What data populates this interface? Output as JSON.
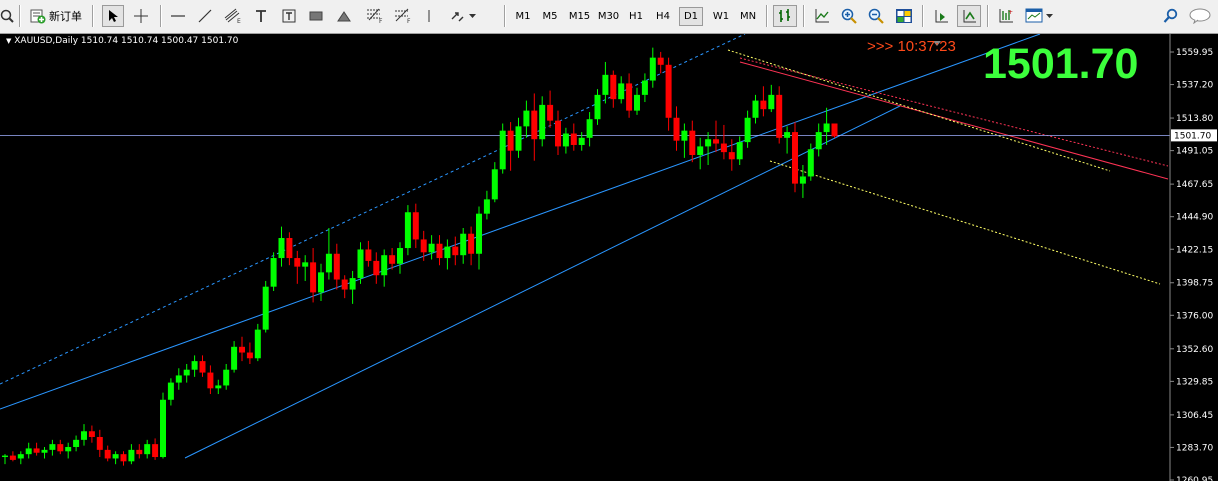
{
  "toolbar": {
    "new_order_label": "新订单",
    "timeframes": [
      "M1",
      "M5",
      "M15",
      "M30",
      "H1",
      "H4",
      "D1",
      "W1",
      "MN"
    ],
    "active_timeframe": "D1"
  },
  "chart": {
    "symbol_line": "XAUUSD,Daily  1510.74 1510.74 1500.47 1501.70",
    "timer": ">>> 10:37:23",
    "big_price": "1501.70",
    "current_price_label": "1501.70",
    "y_ticks": [
      "1559.95",
      "1537.20",
      "1513.80",
      "1491.05",
      "1467.65",
      "1444.90",
      "1422.15",
      "1398.75",
      "1376.00",
      "1352.60",
      "1329.85",
      "1306.45",
      "1283.70",
      "1260.95"
    ],
    "colors": {
      "bull": "#00ff00",
      "bear": "#ff0000",
      "channel": "#1e90ff",
      "trend_red": "#ff3355",
      "trend_yellow": "#ffff66",
      "price_line": "#a0b0ff"
    }
  },
  "chart_data": {
    "type": "candlestick",
    "title": "XAUUSD,Daily",
    "ylim": [
      1256,
      1568
    ],
    "last": {
      "open": 1510.74,
      "high": 1510.74,
      "low": 1500.47,
      "close": 1501.7
    },
    "candles": [
      [
        1277,
        1279,
        1272,
        1278
      ],
      [
        1278,
        1281,
        1274,
        1275
      ],
      [
        1276,
        1281,
        1272,
        1279
      ],
      [
        1279,
        1287,
        1276,
        1283
      ],
      [
        1283,
        1287,
        1278,
        1280
      ],
      [
        1280,
        1284,
        1276,
        1282
      ],
      [
        1282,
        1289,
        1278,
        1286
      ],
      [
        1286,
        1289,
        1279,
        1281
      ],
      [
        1281,
        1287,
        1276,
        1284
      ],
      [
        1284,
        1292,
        1281,
        1289
      ],
      [
        1289,
        1300,
        1285,
        1295
      ],
      [
        1295,
        1299,
        1287,
        1291
      ],
      [
        1291,
        1296,
        1277,
        1282
      ],
      [
        1282,
        1285,
        1274,
        1276
      ],
      [
        1276,
        1281,
        1272,
        1279
      ],
      [
        1279,
        1281,
        1271,
        1274
      ],
      [
        1274,
        1286,
        1272,
        1282
      ],
      [
        1282,
        1286,
        1276,
        1279
      ],
      [
        1279,
        1289,
        1276,
        1286
      ],
      [
        1286,
        1290,
        1275,
        1277
      ],
      [
        1277,
        1322,
        1276,
        1317
      ],
      [
        1317,
        1332,
        1313,
        1329
      ],
      [
        1329,
        1339,
        1324,
        1334
      ],
      [
        1334,
        1342,
        1329,
        1338
      ],
      [
        1338,
        1348,
        1333,
        1344
      ],
      [
        1344,
        1348,
        1333,
        1336
      ],
      [
        1336,
        1341,
        1321,
        1325
      ],
      [
        1325,
        1331,
        1321,
        1327
      ],
      [
        1327,
        1342,
        1324,
        1338
      ],
      [
        1338,
        1358,
        1336,
        1354
      ],
      [
        1354,
        1361,
        1344,
        1350
      ],
      [
        1350,
        1357,
        1342,
        1346
      ],
      [
        1346,
        1370,
        1344,
        1366
      ],
      [
        1366,
        1400,
        1364,
        1396
      ],
      [
        1396,
        1420,
        1393,
        1416
      ],
      [
        1416,
        1438,
        1410,
        1430
      ],
      [
        1430,
        1434,
        1411,
        1416
      ],
      [
        1416,
        1421,
        1398,
        1410
      ],
      [
        1410,
        1418,
        1400,
        1413
      ],
      [
        1413,
        1423,
        1385,
        1392
      ],
      [
        1392,
        1412,
        1386,
        1406
      ],
      [
        1406,
        1437,
        1401,
        1419
      ],
      [
        1419,
        1426,
        1394,
        1401
      ],
      [
        1401,
        1404,
        1388,
        1394
      ],
      [
        1394,
        1407,
        1384,
        1402
      ],
      [
        1402,
        1427,
        1398,
        1422
      ],
      [
        1422,
        1428,
        1410,
        1414
      ],
      [
        1414,
        1420,
        1398,
        1404
      ],
      [
        1404,
        1422,
        1396,
        1418
      ],
      [
        1418,
        1423,
        1408,
        1412
      ],
      [
        1412,
        1427,
        1405,
        1423
      ],
      [
        1423,
        1453,
        1418,
        1448
      ],
      [
        1448,
        1454,
        1423,
        1429
      ],
      [
        1429,
        1435,
        1414,
        1420
      ],
      [
        1420,
        1432,
        1415,
        1426
      ],
      [
        1426,
        1432,
        1411,
        1416
      ],
      [
        1416,
        1429,
        1408,
        1424
      ],
      [
        1424,
        1431,
        1411,
        1418
      ],
      [
        1418,
        1437,
        1412,
        1433
      ],
      [
        1433,
        1438,
        1411,
        1419
      ],
      [
        1419,
        1452,
        1408,
        1447
      ],
      [
        1447,
        1463,
        1443,
        1457
      ],
      [
        1457,
        1483,
        1455,
        1478
      ],
      [
        1478,
        1510,
        1475,
        1505
      ],
      [
        1505,
        1511,
        1477,
        1491
      ],
      [
        1491,
        1514,
        1486,
        1508
      ],
      [
        1508,
        1526,
        1500,
        1519
      ],
      [
        1519,
        1531,
        1484,
        1499
      ],
      [
        1499,
        1529,
        1494,
        1523
      ],
      [
        1523,
        1533,
        1507,
        1512
      ],
      [
        1512,
        1519,
        1488,
        1494
      ],
      [
        1494,
        1507,
        1489,
        1503
      ],
      [
        1503,
        1510,
        1491,
        1495
      ],
      [
        1495,
        1504,
        1491,
        1500
      ],
      [
        1500,
        1518,
        1494,
        1513
      ],
      [
        1513,
        1534,
        1509,
        1530
      ],
      [
        1530,
        1553,
        1524,
        1544
      ],
      [
        1544,
        1547,
        1521,
        1527
      ],
      [
        1527,
        1543,
        1524,
        1538
      ],
      [
        1538,
        1545,
        1514,
        1519
      ],
      [
        1519,
        1535,
        1516,
        1530
      ],
      [
        1530,
        1545,
        1525,
        1540
      ],
      [
        1540,
        1563,
        1535,
        1556
      ],
      [
        1556,
        1560,
        1545,
        1551
      ],
      [
        1551,
        1556,
        1505,
        1514
      ],
      [
        1514,
        1522,
        1491,
        1498
      ],
      [
        1498,
        1510,
        1486,
        1505
      ],
      [
        1505,
        1512,
        1483,
        1488
      ],
      [
        1488,
        1500,
        1478,
        1494
      ],
      [
        1494,
        1504,
        1481,
        1499
      ],
      [
        1499,
        1512,
        1490,
        1496
      ],
      [
        1496,
        1509,
        1485,
        1490
      ],
      [
        1490,
        1499,
        1477,
        1485
      ],
      [
        1485,
        1501,
        1481,
        1497
      ],
      [
        1497,
        1519,
        1493,
        1514
      ],
      [
        1514,
        1530,
        1510,
        1526
      ],
      [
        1526,
        1536,
        1515,
        1520
      ],
      [
        1520,
        1537,
        1518,
        1530
      ],
      [
        1530,
        1536,
        1496,
        1500
      ],
      [
        1500,
        1508,
        1489,
        1504
      ],
      [
        1504,
        1511,
        1462,
        1468
      ],
      [
        1468,
        1481,
        1458,
        1473
      ],
      [
        1473,
        1496,
        1470,
        1492
      ],
      [
        1492,
        1510,
        1487,
        1504
      ],
      [
        1504,
        1521,
        1495,
        1510
      ],
      [
        1510,
        1510,
        1500,
        1501
      ]
    ],
    "price_line": 1501.7
  }
}
